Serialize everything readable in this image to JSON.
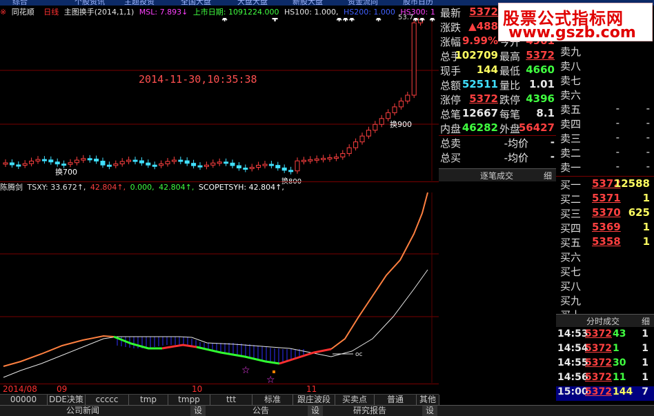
{
  "top_nav": [
    "综合",
    "个股资讯",
    "主题投资",
    "全国大盘",
    "大盘大盘",
    "新股大盘",
    "资金流向",
    "股市日历"
  ],
  "header": {
    "app_name": "同花顺",
    "period": "日线",
    "indicator": "主图换手(2014,1,1)",
    "msl": "MSL: 7.893↓",
    "listing": "上市日期: 1091224.000",
    "hs100": "HS100: 1.000,",
    "hs200": "HS200: 1.000",
    "hs300": "HS300: 1"
  },
  "chart": {
    "timestamp": "2014-11-30,10:35:38",
    "high_label": "53.7",
    "labels": [
      "换700",
      "换900",
      "换800"
    ],
    "axis_dates": [
      "2014/08",
      "09",
      "10",
      "11"
    ]
  },
  "indicator": {
    "name": "陈腾剑",
    "values": [
      "TSXY: 33.672↑,",
      "42.804↑,",
      "0.000,",
      "42.804↑,",
      "SCOPETSYH: 42.804↑,"
    ],
    "cross_label": "oc"
  },
  "quote": {
    "rows": [
      {
        "l1": "最新",
        "v1": "5372",
        "l2": "",
        "v2": ""
      },
      {
        "l1": "涨跌",
        "v1": "▲488",
        "l2": "",
        "v2": ""
      },
      {
        "l1": "涨幅",
        "v1": "9.99%",
        "l2": "今开",
        "v2": "4901"
      },
      {
        "l1": "总手",
        "v1": "102709",
        "l2": "最高",
        "v2": "5372"
      },
      {
        "l1": "现手",
        "v1": "144",
        "l2": "最低",
        "v2": "4660"
      },
      {
        "l1": "总额",
        "v1": "52511",
        "l2": "量比",
        "v2": "1.01"
      },
      {
        "l1": "涨停",
        "v1": "5372",
        "l2": "跌停",
        "v2": "4396"
      },
      {
        "l1": "总笔",
        "v1": "12667",
        "l2": "每笔",
        "v2": "8.1"
      },
      {
        "l1": "内盘",
        "v1": "46282",
        "l2": "外盘",
        "v2": "56427"
      },
      {
        "l1": "总卖",
        "v1": "-均价",
        "l2": "",
        "v2": "-"
      },
      {
        "l1": "总买",
        "v1": "-均价",
        "l2": "",
        "v2": "-"
      }
    ],
    "colors": {
      "red": "#ff4040",
      "green": "#40ff40",
      "yellow": "#ffff60",
      "white": "#e8e8e8",
      "cyan": "#40e0ff"
    }
  },
  "ticks_header": "逐笔成交",
  "ticks_btn": "细",
  "book": {
    "sells": [
      {
        "label": "卖九",
        "price": "",
        "qty": ""
      },
      {
        "label": "卖八",
        "price": "",
        "qty": ""
      },
      {
        "label": "卖七",
        "price": "",
        "qty": ""
      },
      {
        "label": "卖六",
        "price": "",
        "qty": ""
      },
      {
        "label": "卖五",
        "price": "-",
        "qty": "-"
      },
      {
        "label": "卖四",
        "price": "-",
        "qty": "-"
      },
      {
        "label": "卖三",
        "price": "-",
        "qty": "-"
      },
      {
        "label": "卖二",
        "price": "-",
        "qty": "-"
      },
      {
        "label": "卖一",
        "price": "-",
        "qty": "-"
      }
    ],
    "buys": [
      {
        "label": "买一",
        "price": "5372",
        "qty": "12588"
      },
      {
        "label": "买二",
        "price": "5371",
        "qty": "1"
      },
      {
        "label": "买三",
        "price": "5370",
        "qty": "625"
      },
      {
        "label": "买四",
        "price": "5369",
        "qty": "1"
      },
      {
        "label": "买五",
        "price": "5358",
        "qty": "1"
      },
      {
        "label": "买六",
        "price": "",
        "qty": ""
      },
      {
        "label": "买七",
        "price": "",
        "qty": ""
      },
      {
        "label": "买八",
        "price": "",
        "qty": ""
      },
      {
        "label": "买九",
        "price": "",
        "qty": ""
      },
      {
        "label": "买十",
        "price": "",
        "qty": ""
      }
    ]
  },
  "time_trades": {
    "header": "分时成交",
    "btn": "细",
    "rows": [
      {
        "t": "14:53",
        "p": "5372",
        "v": "43",
        "n": "1"
      },
      {
        "t": "14:54",
        "p": "5372",
        "v": "1",
        "n": "1"
      },
      {
        "t": "14:55",
        "p": "5372",
        "v": "30",
        "n": "1"
      },
      {
        "t": "14:56",
        "p": "5372",
        "v": "11",
        "n": "1"
      },
      {
        "t": "15:00",
        "p": "5372",
        "v": "144",
        "n": "7"
      }
    ]
  },
  "tabs": [
    "00000",
    "DDE决策",
    "ccccc",
    "tmp",
    "tmpp",
    "ttt",
    "标准",
    "跟庄波段",
    "买卖点",
    "普通",
    "其他"
  ],
  "bottom_tabs": [
    "公司新闻",
    "设",
    "公告",
    "设",
    "研究报告",
    "设"
  ],
  "watermark": {
    "line1": "股票公式指标网",
    "line2": "www.gszb.com"
  }
}
